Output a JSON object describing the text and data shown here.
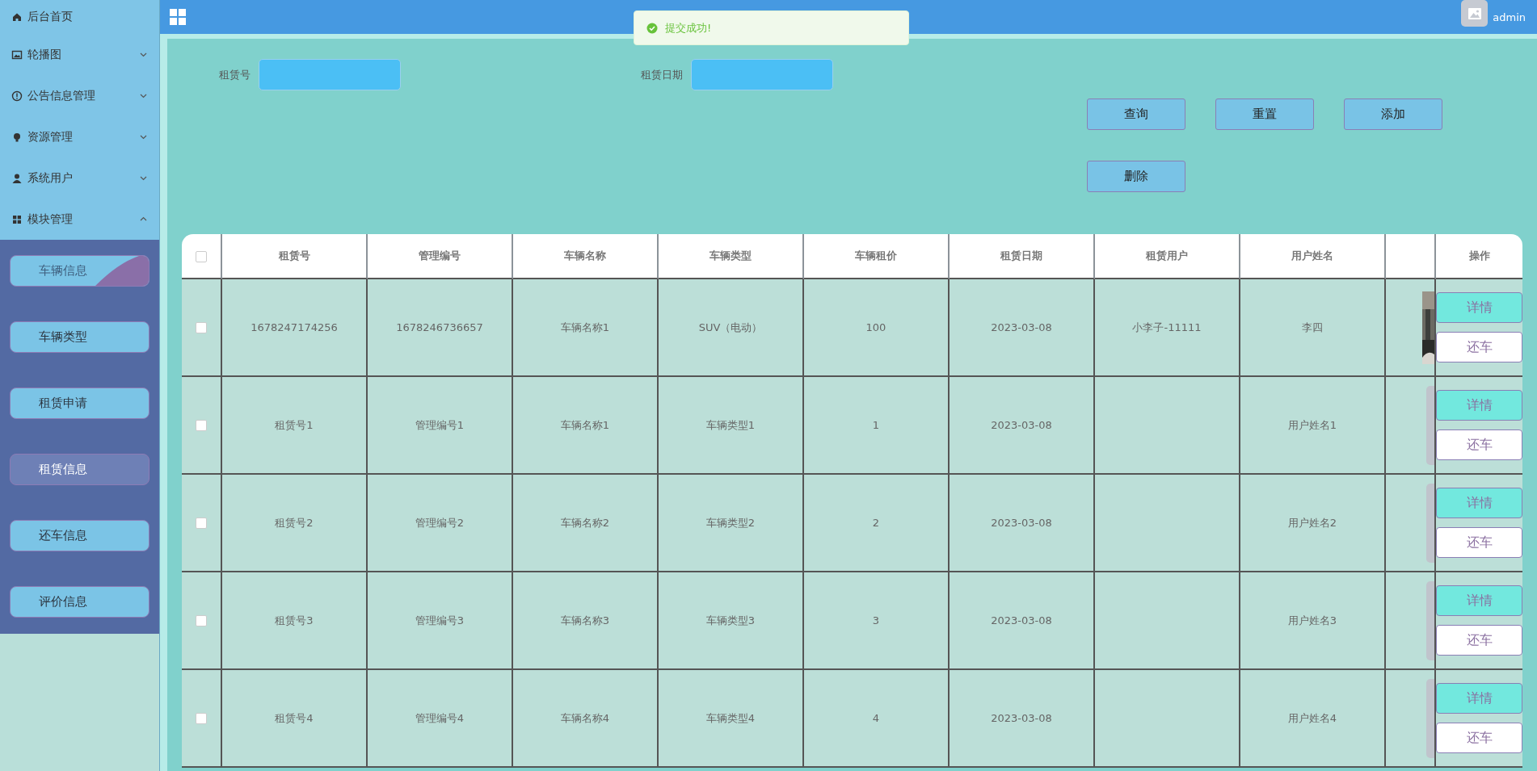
{
  "topbar": {
    "user": "admin"
  },
  "toast": {
    "kind": "success",
    "message": "提交成功!"
  },
  "sidebar": {
    "home": "后台首页",
    "menus": [
      {
        "label": "轮播图",
        "expanded": false
      },
      {
        "label": "公告信息管理",
        "expanded": false
      },
      {
        "label": "资源管理",
        "expanded": false
      },
      {
        "label": "系统用户",
        "expanded": false
      },
      {
        "label": "模块管理",
        "expanded": true
      }
    ],
    "submenu": [
      {
        "label": "车辆信息",
        "selected": false,
        "hovered": true
      },
      {
        "label": "车辆类型",
        "selected": false,
        "hovered": false
      },
      {
        "label": "租赁申请",
        "selected": false,
        "hovered": false
      },
      {
        "label": "租赁信息",
        "selected": true,
        "hovered": false
      },
      {
        "label": "还车信息",
        "selected": false,
        "hovered": false
      },
      {
        "label": "评价信息",
        "selected": false,
        "hovered": false
      }
    ]
  },
  "search": {
    "fields": [
      {
        "label": "租赁号"
      },
      {
        "label": "租赁日期"
      }
    ],
    "buttons": [
      "查询",
      "重置",
      "添加",
      "删除"
    ]
  },
  "table": {
    "columns": [
      {
        "kind": "checkbox",
        "checked": false
      },
      "租赁号",
      "管理编号",
      "车辆名称",
      "车辆类型",
      "车辆租价",
      "租赁日期",
      "租赁用户",
      "用户姓名",
      "",
      "操作"
    ],
    "rows": [
      {
        "cells": [
          {
            "kind": "checkbox",
            "checked": false
          },
          "1678247174256",
          "1678246736657",
          "车辆名称1",
          "SUV（电动）",
          "100",
          "2023-03-08",
          "小李子-11111",
          "李四",
          {
            "kind": "picture"
          },
          {
            "kind": "actions",
            "buttons": [
              "详情",
              "还车"
            ]
          }
        ]
      },
      {
        "cells": [
          {
            "kind": "checkbox",
            "checked": false
          },
          "租赁号1",
          "管理编号1",
          "车辆名称1",
          "车辆类型1",
          "1",
          "2023-03-08",
          "",
          "用户姓名1",
          {
            "kind": "placeholder"
          },
          {
            "kind": "actions",
            "buttons": [
              "详情",
              "还车"
            ]
          }
        ]
      },
      {
        "cells": [
          {
            "kind": "checkbox",
            "checked": false
          },
          "租赁号2",
          "管理编号2",
          "车辆名称2",
          "车辆类型2",
          "2",
          "2023-03-08",
          "",
          "用户姓名2",
          {
            "kind": "placeholder"
          },
          {
            "kind": "actions",
            "buttons": [
              "详情",
              "还车"
            ]
          }
        ]
      },
      {
        "cells": [
          {
            "kind": "checkbox",
            "checked": false
          },
          "租赁号3",
          "管理编号3",
          "车辆名称3",
          "车辆类型3",
          "3",
          "2023-03-08",
          "",
          "用户姓名3",
          {
            "kind": "placeholder"
          },
          {
            "kind": "actions",
            "buttons": [
              "详情",
              "还车"
            ]
          }
        ]
      },
      {
        "cells": [
          {
            "kind": "checkbox",
            "checked": false
          },
          "租赁号4",
          "管理编号4",
          "车辆名称4",
          "车辆类型4",
          "4",
          "2023-03-08",
          "",
          "用户姓名4",
          {
            "kind": "placeholder"
          },
          {
            "kind": "actions",
            "buttons": [
              "详情",
              "还车"
            ]
          }
        ]
      }
    ]
  }
}
